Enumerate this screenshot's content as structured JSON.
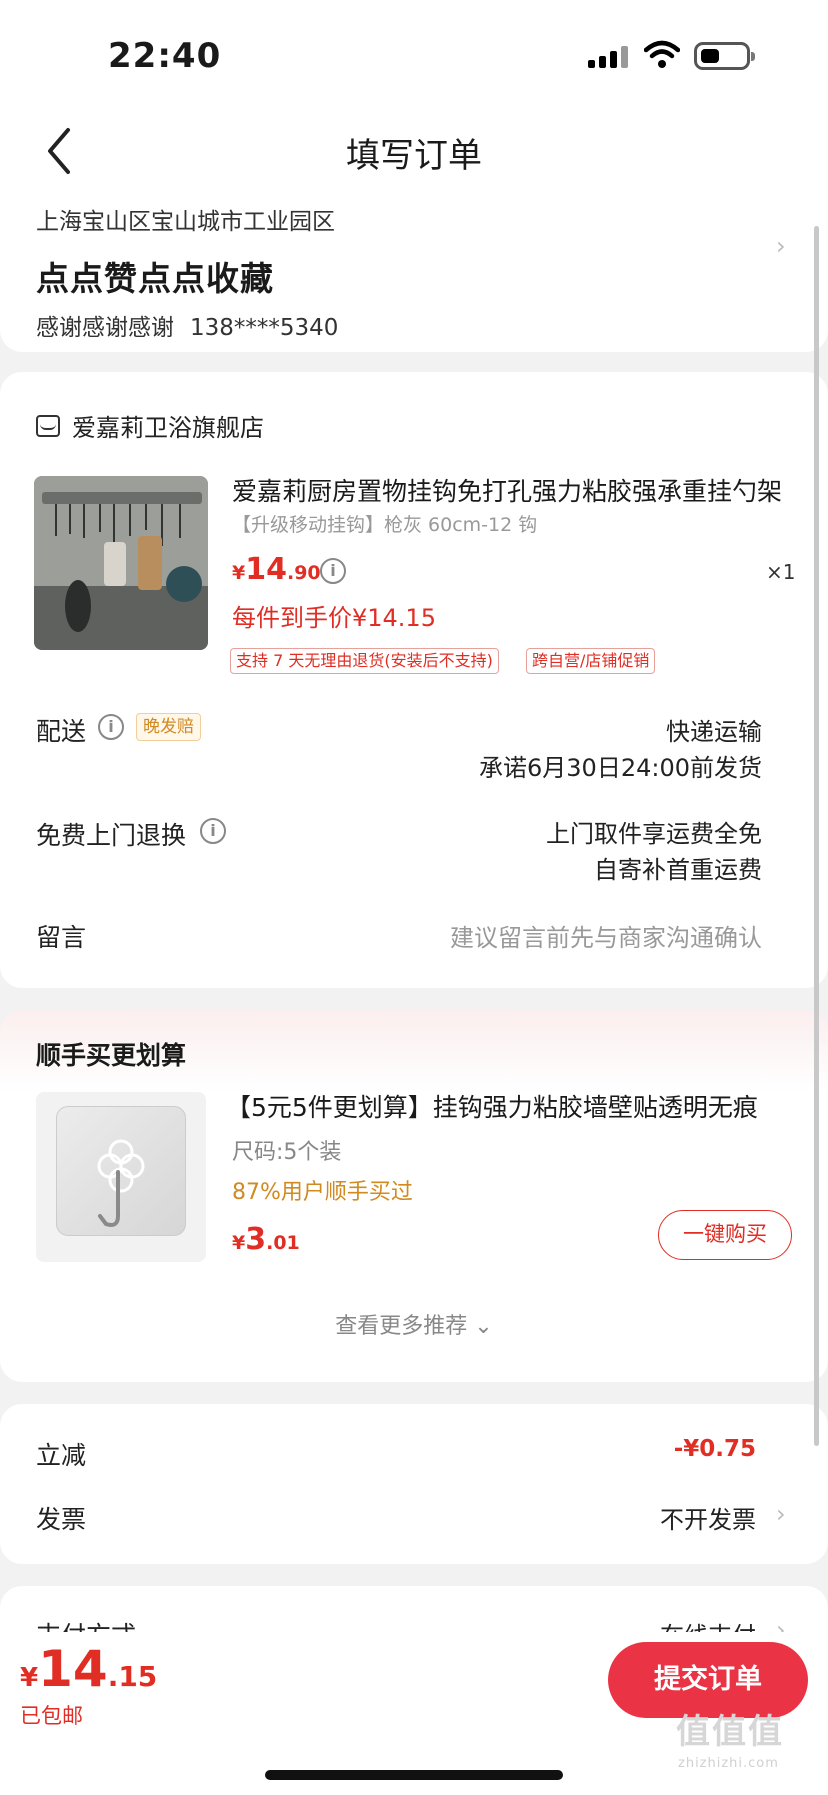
{
  "status_bar": {
    "time": "22:40"
  },
  "nav": {
    "title": "填写订单"
  },
  "address": {
    "line": "上海宝山区宝山城市工业园区",
    "name": "点点赞点点收藏",
    "recipient": "感谢感谢感谢",
    "phone": "138****5340"
  },
  "shop": {
    "name": "爱嘉莉卫浴旗舰店"
  },
  "product": {
    "title": "爱嘉莉厨房置物挂钩免打孔强力粘胶强承重挂勺架",
    "sku": "【升级移动挂钩】枪灰 60cm-12 钩",
    "price_symbol": "¥",
    "price_int": "14",
    "price_dec": ".90",
    "quantity": "×1",
    "final_price": "每件到手价¥14.15",
    "tags": [
      "支持 7 天无理由退货(安装后不支持)",
      "跨自营/店铺促销"
    ]
  },
  "delivery": {
    "label": "配送",
    "badge": "晚发赔",
    "method": "快递运输",
    "promise": "承诺6月30日24:00前发货"
  },
  "returns": {
    "label": "免费上门退换",
    "line1": "上门取件享运费全免",
    "line2": "自寄补首重运费"
  },
  "message": {
    "label": "留言",
    "placeholder": "建议留言前先与商家沟通确认"
  },
  "recommend": {
    "title": "顺手买更划算",
    "item_name": "【5元5件更划算】挂钩强力粘胶墙壁贴透明无痕",
    "spec": "尺码:5个装",
    "bought": "87%用户顺手买过",
    "price_symbol": "¥",
    "price_int": "3",
    "price_dec": ".01",
    "buy_label": "一键购买",
    "more_label": "查看更多推荐"
  },
  "summary": {
    "discount_label": "立减",
    "discount_value": "-¥0.75",
    "invoice_label": "发票",
    "invoice_value": "不开发票"
  },
  "payment": {
    "label": "支付方式",
    "value": "在线支付"
  },
  "bottom": {
    "total_symbol": "¥",
    "total_int": "14",
    "total_dec": ".15",
    "shipping": "已包邮",
    "submit_label": "提交订单",
    "watermark": "值值值",
    "watermark_sub": "zhizhizhi.com"
  },
  "colors": {
    "accent": "#e02e24",
    "submit": "#ea3446",
    "badge": "#d08a20"
  }
}
